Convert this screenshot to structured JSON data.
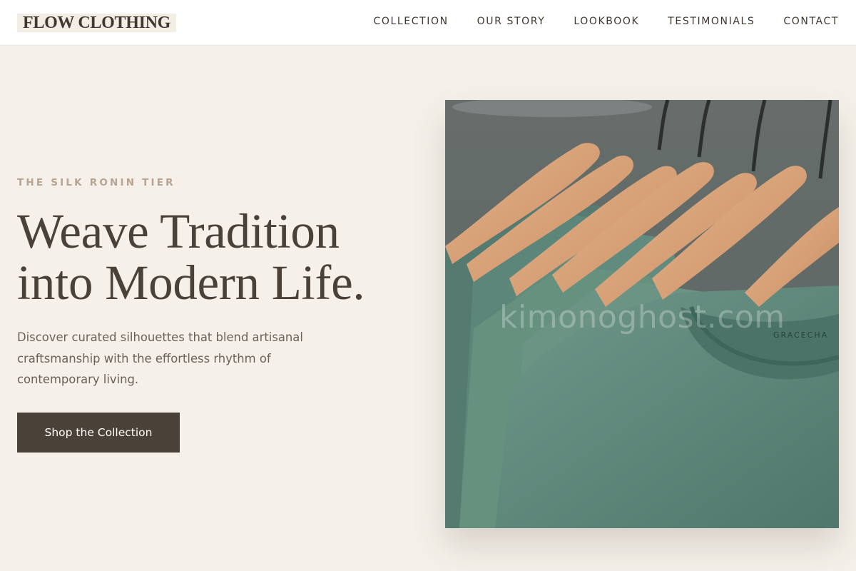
{
  "brand": {
    "name": "FLOW CLOTHING"
  },
  "nav": {
    "links": [
      "COLLECTION",
      "OUR STORY",
      "LOOKBOOK",
      "TESTIMONIALS",
      "CONTACT"
    ]
  },
  "hero": {
    "eyebrow": "THE SILK RONIN TIER",
    "headline_line1": "Weave Tradition",
    "headline_line2": "into Modern Life.",
    "description": "Discover curated silhouettes that blend artisanal craftsmanship with the effortless rhythm of contemporary living.",
    "cta_label": "Shop the Collection"
  },
  "image": {
    "subject": "green t-shirts on wooden hangers",
    "label_text": "GRACECHA",
    "watermark": "kimonoghost.com"
  },
  "colors": {
    "background": "#f5f1ea",
    "text": "#4a4238",
    "accent": "#b6a491",
    "button": "#4a4238",
    "shirt": "#5f8a7c",
    "hanger": "#d4a07a"
  }
}
